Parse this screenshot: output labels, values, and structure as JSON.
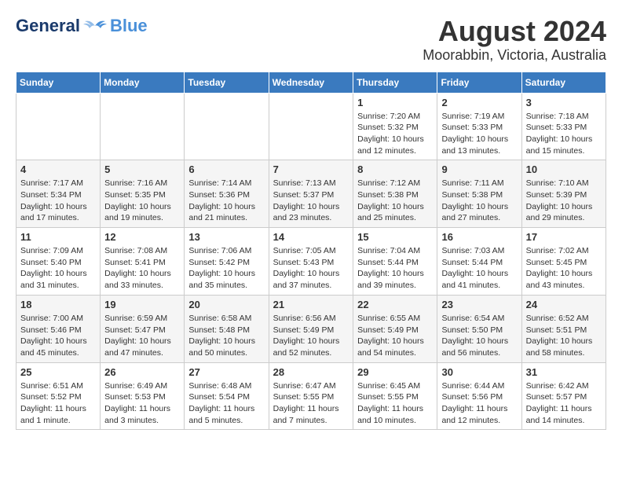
{
  "header": {
    "logo_general": "General",
    "logo_blue": "Blue",
    "title": "August 2024",
    "subtitle": "Moorabbin, Victoria, Australia"
  },
  "days_of_week": [
    "Sunday",
    "Monday",
    "Tuesday",
    "Wednesday",
    "Thursday",
    "Friday",
    "Saturday"
  ],
  "weeks": [
    {
      "days": [
        {
          "num": "",
          "info": ""
        },
        {
          "num": "",
          "info": ""
        },
        {
          "num": "",
          "info": ""
        },
        {
          "num": "",
          "info": ""
        },
        {
          "num": "1",
          "info": "Sunrise: 7:20 AM\nSunset: 5:32 PM\nDaylight: 10 hours\nand 12 minutes."
        },
        {
          "num": "2",
          "info": "Sunrise: 7:19 AM\nSunset: 5:33 PM\nDaylight: 10 hours\nand 13 minutes."
        },
        {
          "num": "3",
          "info": "Sunrise: 7:18 AM\nSunset: 5:33 PM\nDaylight: 10 hours\nand 15 minutes."
        }
      ]
    },
    {
      "days": [
        {
          "num": "4",
          "info": "Sunrise: 7:17 AM\nSunset: 5:34 PM\nDaylight: 10 hours\nand 17 minutes."
        },
        {
          "num": "5",
          "info": "Sunrise: 7:16 AM\nSunset: 5:35 PM\nDaylight: 10 hours\nand 19 minutes."
        },
        {
          "num": "6",
          "info": "Sunrise: 7:14 AM\nSunset: 5:36 PM\nDaylight: 10 hours\nand 21 minutes."
        },
        {
          "num": "7",
          "info": "Sunrise: 7:13 AM\nSunset: 5:37 PM\nDaylight: 10 hours\nand 23 minutes."
        },
        {
          "num": "8",
          "info": "Sunrise: 7:12 AM\nSunset: 5:38 PM\nDaylight: 10 hours\nand 25 minutes."
        },
        {
          "num": "9",
          "info": "Sunrise: 7:11 AM\nSunset: 5:38 PM\nDaylight: 10 hours\nand 27 minutes."
        },
        {
          "num": "10",
          "info": "Sunrise: 7:10 AM\nSunset: 5:39 PM\nDaylight: 10 hours\nand 29 minutes."
        }
      ]
    },
    {
      "days": [
        {
          "num": "11",
          "info": "Sunrise: 7:09 AM\nSunset: 5:40 PM\nDaylight: 10 hours\nand 31 minutes."
        },
        {
          "num": "12",
          "info": "Sunrise: 7:08 AM\nSunset: 5:41 PM\nDaylight: 10 hours\nand 33 minutes."
        },
        {
          "num": "13",
          "info": "Sunrise: 7:06 AM\nSunset: 5:42 PM\nDaylight: 10 hours\nand 35 minutes."
        },
        {
          "num": "14",
          "info": "Sunrise: 7:05 AM\nSunset: 5:43 PM\nDaylight: 10 hours\nand 37 minutes."
        },
        {
          "num": "15",
          "info": "Sunrise: 7:04 AM\nSunset: 5:44 PM\nDaylight: 10 hours\nand 39 minutes."
        },
        {
          "num": "16",
          "info": "Sunrise: 7:03 AM\nSunset: 5:44 PM\nDaylight: 10 hours\nand 41 minutes."
        },
        {
          "num": "17",
          "info": "Sunrise: 7:02 AM\nSunset: 5:45 PM\nDaylight: 10 hours\nand 43 minutes."
        }
      ]
    },
    {
      "days": [
        {
          "num": "18",
          "info": "Sunrise: 7:00 AM\nSunset: 5:46 PM\nDaylight: 10 hours\nand 45 minutes."
        },
        {
          "num": "19",
          "info": "Sunrise: 6:59 AM\nSunset: 5:47 PM\nDaylight: 10 hours\nand 47 minutes."
        },
        {
          "num": "20",
          "info": "Sunrise: 6:58 AM\nSunset: 5:48 PM\nDaylight: 10 hours\nand 50 minutes."
        },
        {
          "num": "21",
          "info": "Sunrise: 6:56 AM\nSunset: 5:49 PM\nDaylight: 10 hours\nand 52 minutes."
        },
        {
          "num": "22",
          "info": "Sunrise: 6:55 AM\nSunset: 5:49 PM\nDaylight: 10 hours\nand 54 minutes."
        },
        {
          "num": "23",
          "info": "Sunrise: 6:54 AM\nSunset: 5:50 PM\nDaylight: 10 hours\nand 56 minutes."
        },
        {
          "num": "24",
          "info": "Sunrise: 6:52 AM\nSunset: 5:51 PM\nDaylight: 10 hours\nand 58 minutes."
        }
      ]
    },
    {
      "days": [
        {
          "num": "25",
          "info": "Sunrise: 6:51 AM\nSunset: 5:52 PM\nDaylight: 11 hours\nand 1 minute."
        },
        {
          "num": "26",
          "info": "Sunrise: 6:49 AM\nSunset: 5:53 PM\nDaylight: 11 hours\nand 3 minutes."
        },
        {
          "num": "27",
          "info": "Sunrise: 6:48 AM\nSunset: 5:54 PM\nDaylight: 11 hours\nand 5 minutes."
        },
        {
          "num": "28",
          "info": "Sunrise: 6:47 AM\nSunset: 5:55 PM\nDaylight: 11 hours\nand 7 minutes."
        },
        {
          "num": "29",
          "info": "Sunrise: 6:45 AM\nSunset: 5:55 PM\nDaylight: 11 hours\nand 10 minutes."
        },
        {
          "num": "30",
          "info": "Sunrise: 6:44 AM\nSunset: 5:56 PM\nDaylight: 11 hours\nand 12 minutes."
        },
        {
          "num": "31",
          "info": "Sunrise: 6:42 AM\nSunset: 5:57 PM\nDaylight: 11 hours\nand 14 minutes."
        }
      ]
    }
  ]
}
